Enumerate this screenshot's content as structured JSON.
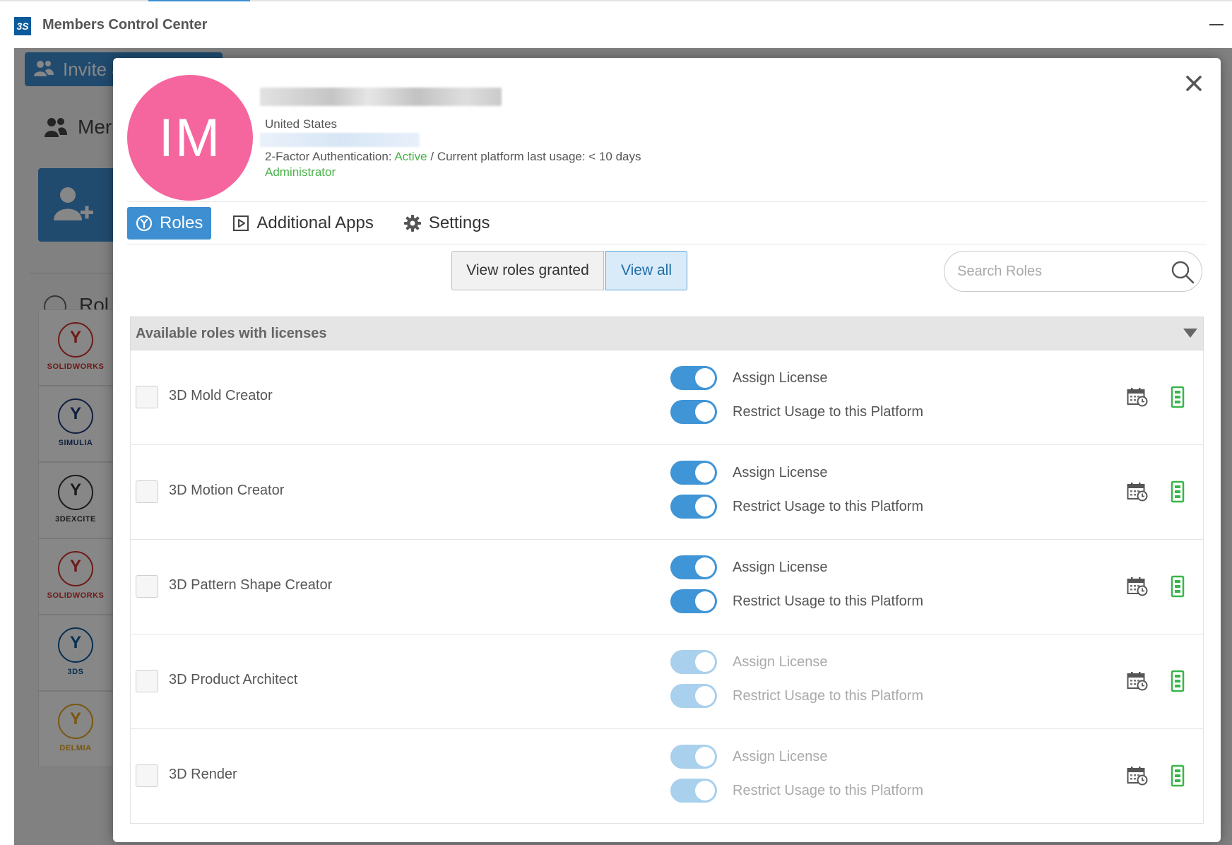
{
  "app": {
    "title": "Members Control Center",
    "logo_text": "3S"
  },
  "background": {
    "invite_label": "Invite &",
    "members_label": "Mer",
    "roles_label": "Rol",
    "brand_cards": [
      {
        "label": "SOLIDWORKS",
        "color": "#d0312d"
      },
      {
        "label": "SIMULIA",
        "color": "#1d3a7a"
      },
      {
        "label": "3DEXCITE",
        "color": "#333333"
      },
      {
        "label": "SOLIDWORKS",
        "color": "#d0312d"
      },
      {
        "label": "3DS",
        "color": "#0a5a9c"
      },
      {
        "label": "DELMIA",
        "color": "#e3a51b"
      }
    ]
  },
  "user": {
    "initials": "IM",
    "country": "United States",
    "mfa_label": "2-Factor Authentication:",
    "mfa_status": "Active",
    "usage_text": "/ Current platform last usage: < 10 days",
    "role": "Administrator",
    "avatar_color": "#f5659e"
  },
  "tabs": [
    {
      "label": "Roles",
      "icon": "roles-icon",
      "active": true
    },
    {
      "label": "Additional Apps",
      "icon": "play-square-icon",
      "active": false
    },
    {
      "label": "Settings",
      "icon": "gear-icon",
      "active": false
    }
  ],
  "view_toggle": {
    "granted_label": "View roles granted",
    "all_label": "View all"
  },
  "search": {
    "placeholder": "Search Roles"
  },
  "section": {
    "title": "Available roles with licenses"
  },
  "toggle_labels": {
    "assign": "Assign License",
    "restrict": "Restrict Usage to this Platform"
  },
  "roles": [
    {
      "name": "3D Mold Creator",
      "assign_enabled": true,
      "restrict_enabled": true
    },
    {
      "name": "3D Motion Creator",
      "assign_enabled": true,
      "restrict_enabled": true
    },
    {
      "name": "3D Pattern Shape Creator",
      "assign_enabled": true,
      "restrict_enabled": true
    },
    {
      "name": "3D Product Architect",
      "assign_enabled": false,
      "restrict_enabled": false
    },
    {
      "name": "3D Render",
      "assign_enabled": false,
      "restrict_enabled": false
    }
  ],
  "colors": {
    "accent": "#3d8fd1",
    "toggle_on": "#3f95d6",
    "toggle_disabled": "#a9d0ec",
    "success": "#4ab34a"
  }
}
